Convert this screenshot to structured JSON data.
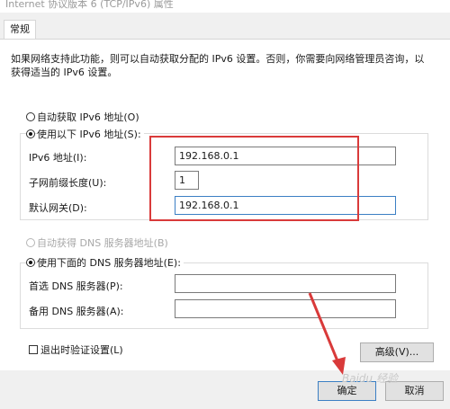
{
  "window": {
    "title": "Internet 协议版本 6 (TCP/IPv6) 属性"
  },
  "tabs": [
    {
      "label": "常规"
    }
  ],
  "description": "如果网络支持此功能，则可以自动获取分配的 IPv6 设置。否则，你需要向网络管理员咨询，以获得适当的 IPv6 设置。",
  "ip_section": {
    "auto_label": "自动获取 IPv6 地址(O)",
    "manual_label": "使用以下 IPv6 地址(S):",
    "selected": "manual",
    "fields": {
      "address_label": "IPv6 地址(I):",
      "address_value": "192.168.0.1",
      "prefix_label": "子网前缀长度(U):",
      "prefix_value": "1",
      "gateway_label": "默认网关(D):",
      "gateway_value": "192.168.0.1"
    }
  },
  "dns_section": {
    "auto_label": "自动获得 DNS 服务器地址(B)",
    "manual_label": "使用下面的 DNS 服务器地址(E):",
    "selected": "manual",
    "fields": {
      "preferred_label": "首选 DNS 服务器(P):",
      "preferred_value": "",
      "alternate_label": "备用 DNS 服务器(A):",
      "alternate_value": ""
    }
  },
  "validate_on_exit": {
    "label": "退出时验证设置(L)",
    "checked": false
  },
  "advanced_button": "高级(V)...",
  "ok_button": "确定",
  "cancel_button": "取消",
  "watermark": "Baidu 经验",
  "colors": {
    "annotation_red": "#d93a3a",
    "focus_border": "#3b7fc4"
  }
}
